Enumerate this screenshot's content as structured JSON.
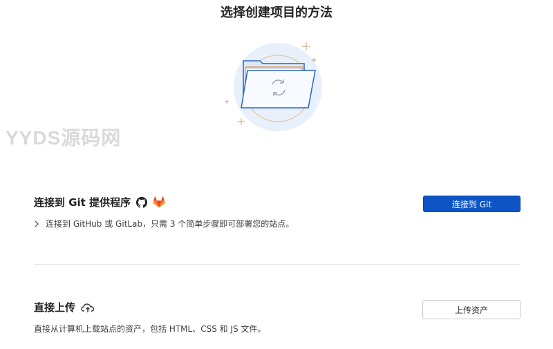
{
  "page": {
    "title": "选择创建项目的方法"
  },
  "watermark": "YYDS源码网",
  "git_section": {
    "title": "连接到 Git 提供程序",
    "description": "连接到 GitHub 或 GitLab，只需 3 个简单步骤即可部署您的站点。",
    "button_label": "连接到 Git",
    "icons": [
      "github-icon",
      "gitlab-icon",
      "chevron-right-icon"
    ]
  },
  "upload_section": {
    "title": "直接上传",
    "description": "直接从计算机上载站点的资产，包括 HTML、CSS 和 JS 文件。",
    "button_label": "上传资产",
    "icons": [
      "cloud-upload-icon"
    ]
  },
  "colors": {
    "primary": "#0d55c7",
    "illustration_circle": "#e8f1fb",
    "illustration_ring": "#e4c6a8"
  }
}
